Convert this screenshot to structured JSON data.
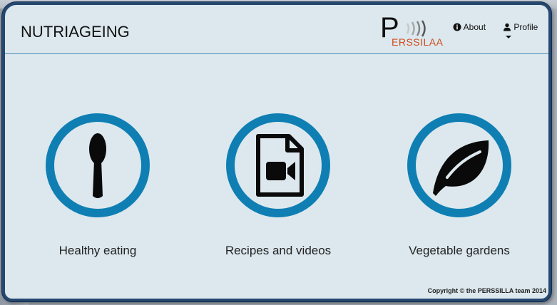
{
  "navbar": {
    "brand": "NUTRIAGEING",
    "logo_text": "ERSSILAA",
    "about_label": "About",
    "profile_label": "Profile"
  },
  "tiles": [
    {
      "label": "Healthy eating",
      "icon": "spoon-icon"
    },
    {
      "label": "Recipes and videos",
      "icon": "video-file-icon"
    },
    {
      "label": "Vegetable gardens",
      "icon": "leaf-icon"
    }
  ],
  "footer": {
    "copyright": "Copyright © the PERSSILLA team 2014"
  },
  "colors": {
    "ring": "#0f7fb3",
    "background": "#dce8ee",
    "frame": "#26476e",
    "logo_accent": "#d24a1a"
  }
}
